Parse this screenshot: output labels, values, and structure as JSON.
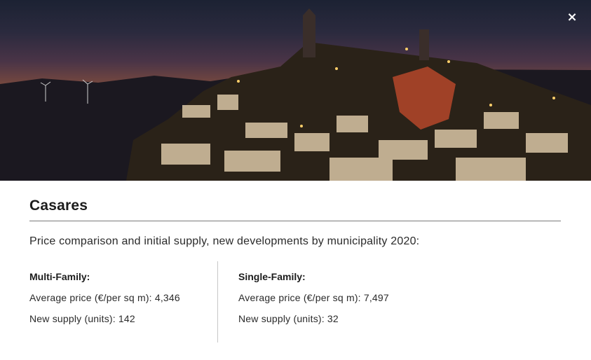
{
  "modal": {
    "close_label": "×",
    "title": "Casares",
    "subtitle": "Price comparison and initial supply, new developments by municipality 2020:"
  },
  "multi_family": {
    "heading": "Multi-Family:",
    "price_label": "Average price (€/per sq m): 4,346",
    "supply_label": "New supply (units): 142"
  },
  "single_family": {
    "heading": "Single-Family:",
    "price_label": "Average price (€/per sq m): 7,497",
    "supply_label": "New supply (units): 32"
  },
  "colors": {
    "text": "#1c1c1c",
    "divider": "#7a7a7a",
    "hero_sky": "#b0603a"
  }
}
